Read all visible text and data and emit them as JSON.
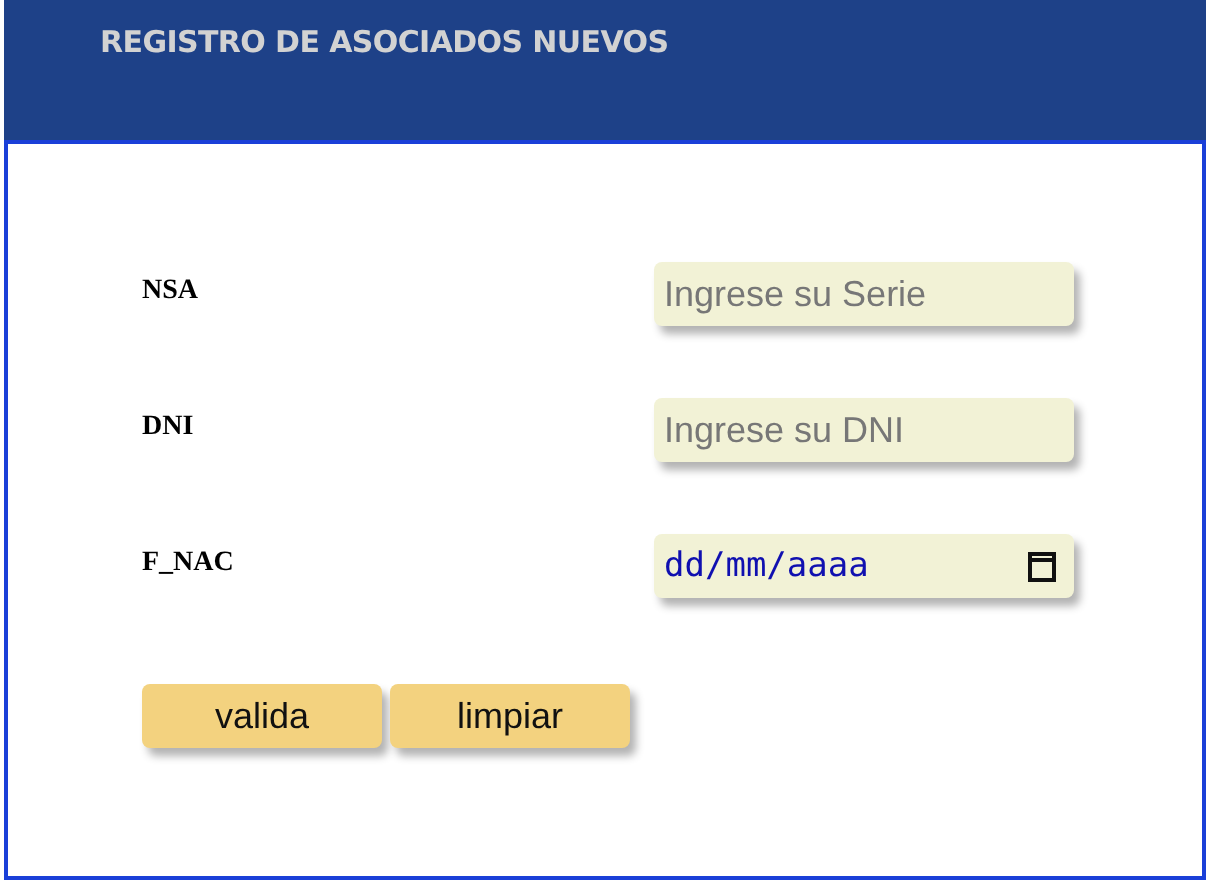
{
  "header": {
    "title": "REGISTRO DE ASOCIADOS NUEVOS"
  },
  "fields": [
    {
      "label": "NSA",
      "kind": "text",
      "placeholder": "Ingrese su Serie"
    },
    {
      "label": "DNI",
      "kind": "text",
      "placeholder": "Ingrese su DNI"
    },
    {
      "label": "F_NAC",
      "kind": "date",
      "placeholder": "dd/mm/aaaa"
    }
  ],
  "buttons": [
    "valida",
    "limpiar"
  ]
}
